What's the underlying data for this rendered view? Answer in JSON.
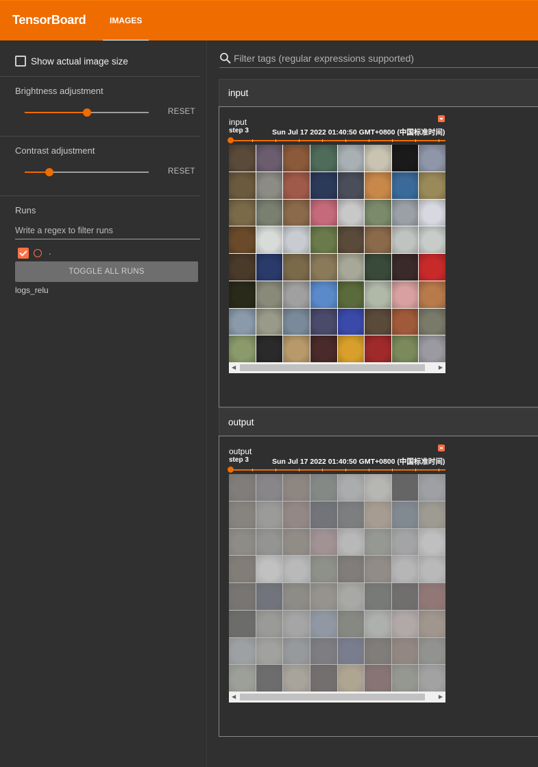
{
  "app": {
    "title": "TensorBoard",
    "tab": "IMAGES",
    "accent": "#ef6c00"
  },
  "sidebar": {
    "show_actual_size_label": "Show actual image size",
    "brightness": {
      "label": "Brightness adjustment",
      "value": 0.5,
      "reset": "RESET"
    },
    "contrast": {
      "label": "Contrast adjustment",
      "value": 0.2,
      "reset": "RESET"
    },
    "runs": {
      "title": "Runs",
      "filter_placeholder": "Write a regex to filter runs",
      "run_label": ".",
      "toggle_all": "TOGGLE ALL RUNS",
      "run_name": "logs_relu"
    }
  },
  "main": {
    "filter_placeholder": "Filter tags (regular expressions supported)",
    "groups": [
      {
        "header": "input",
        "card_title": "input",
        "step": "step 3",
        "date": "Sun Jul 17 2022 01:40:50 GMT+0800 (中国标准时间)"
      },
      {
        "header": "output",
        "card_title": "output",
        "step": "step 3",
        "date": "Sun Jul 17 2022 01:40:50 GMT+0800 (中国标准时间)"
      }
    ],
    "image_palette": [
      "#5a4a3a",
      "#6b5d6e",
      "#8a5a3a",
      "#4f6b5a",
      "#a8b0b4",
      "#c9c3b2",
      "#1a1a1a",
      "#8e96a8",
      "#6b5a3e",
      "#8c8c84",
      "#a05a4a",
      "#2c3a5a",
      "#4a4e5a",
      "#c8884a",
      "#3a6a9a",
      "#9a8a5a",
      "#7a6a48",
      "#7a8070",
      "#8a6a4a",
      "#c46a7a",
      "#c8c8c8",
      "#7a8a6a",
      "#9aa0a6",
      "#d8d8e0",
      "#6a4a2a",
      "#d8dcd8",
      "#c8ccd0",
      "#6a7a4a",
      "#5a4a3a",
      "#8a6a4a",
      "#c0c4c0",
      "#c8ccc8",
      "#4a3a2a",
      "#2a3a6a",
      "#7a6a4a",
      "#8a7a5a",
      "#a8a898",
      "#3a4a3a",
      "#3a2a2a",
      "#c82a2a",
      "#2a2a1a",
      "#8a8a7a",
      "#a0a0a0",
      "#5a8aca",
      "#5a6a3a",
      "#b0b8a8",
      "#d8a0a0",
      "#b87a4a",
      "#8a9aaa",
      "#9a9a8a",
      "#7a8a9a",
      "#4a4a6a",
      "#3a4aaa",
      "#5a4a3a",
      "#a05a3a",
      "#7a7a6a",
      "#8a9a6a",
      "#2a2a2a",
      "#b89a6a",
      "#4a2a2a",
      "#d8a02a",
      "#a02a2a",
      "#7a8a5a",
      "#9a9aa0"
    ]
  }
}
